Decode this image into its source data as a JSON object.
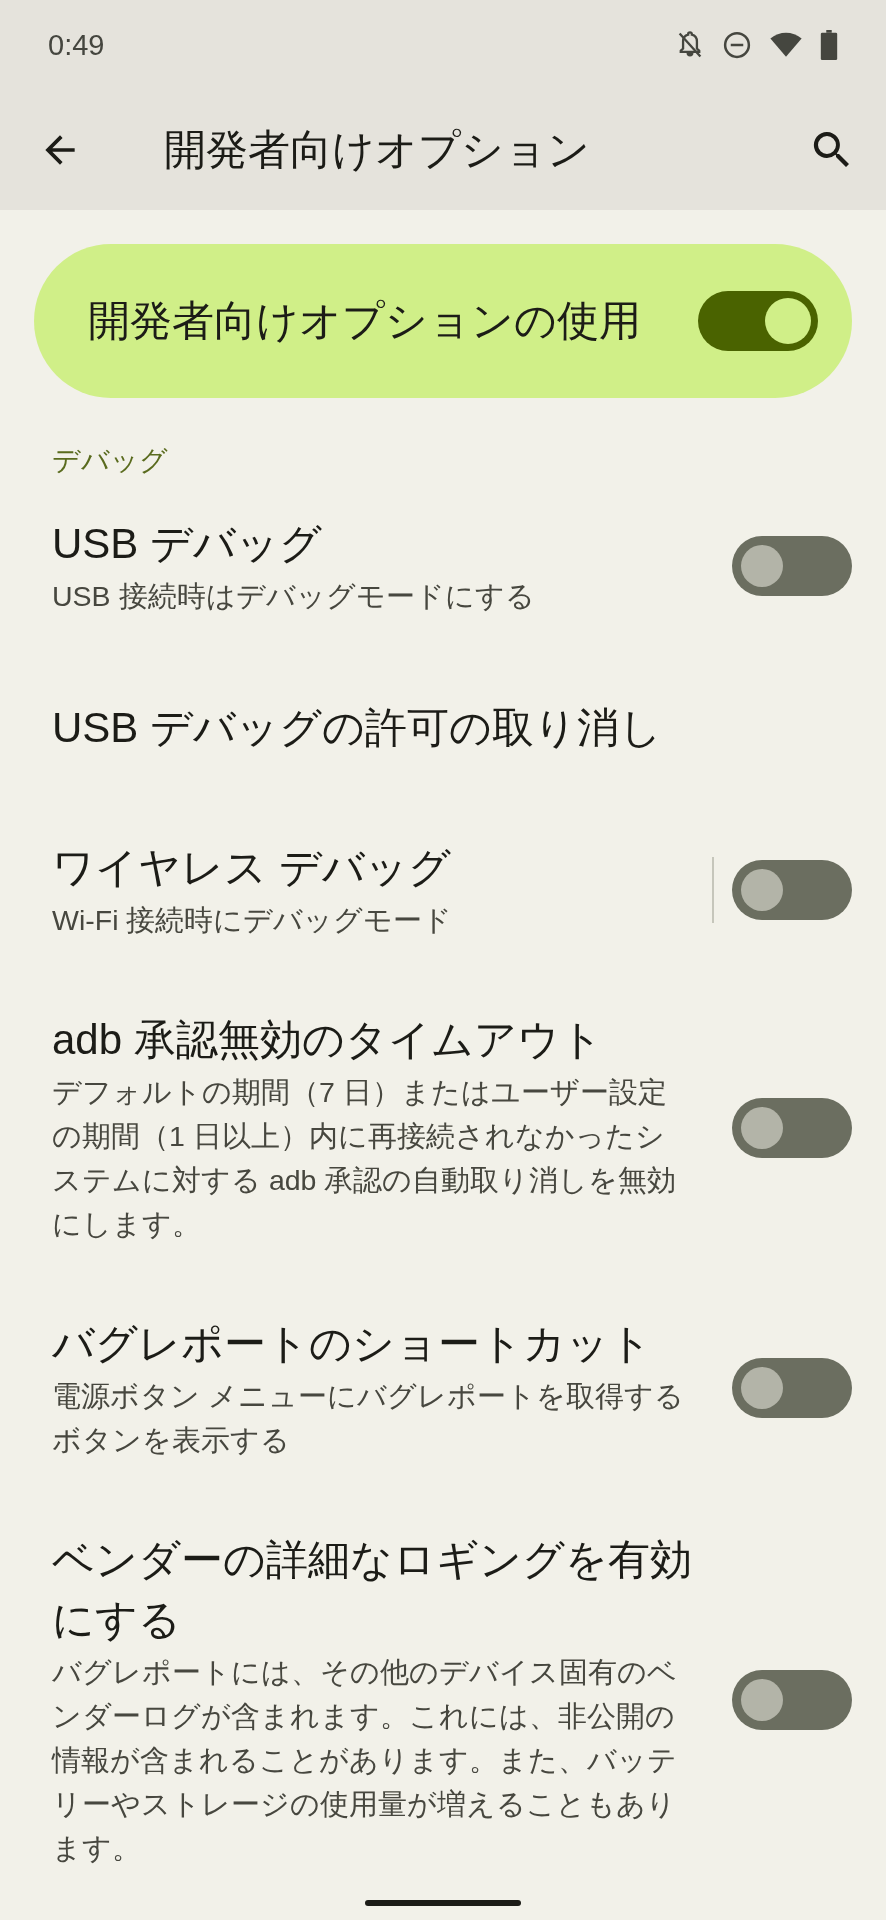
{
  "status_bar": {
    "time": "0:49"
  },
  "app_bar": {
    "title": "開発者向けオプション"
  },
  "main_switch": {
    "label": "開発者向けオプションの使用",
    "on": true
  },
  "section": {
    "title": "デバッグ"
  },
  "items": [
    {
      "kind": "toggle",
      "title": "USB デバッグ",
      "summary": "USB 接続時はデバッグモードにする",
      "on": false,
      "divider": false
    },
    {
      "kind": "plain",
      "title": "USB デバッグの許可の取り消し"
    },
    {
      "kind": "toggle",
      "title": "ワイヤレス デバッグ",
      "summary": "Wi-Fi 接続時にデバッグモード",
      "on": false,
      "divider": true
    },
    {
      "kind": "toggle",
      "title": "adb 承認無効のタイムアウト",
      "summary": "デフォルトの期間（7 日）またはユーザー設定の期間（1 日以上）内に再接続されなかったシステムに対する adb 承認の自動取り消しを無効にします。",
      "on": false,
      "divider": false
    },
    {
      "kind": "toggle",
      "title": "バグレポートのショートカット",
      "summary": "電源ボタン メニューにバグレポートを取得するボタンを表示する",
      "on": false,
      "divider": false
    },
    {
      "kind": "toggle",
      "title": "ベンダーの詳細なロギングを有効にする",
      "summary": "バグレポートには、その他のデバイス固有のベンダーログが含まれます。これには、非公開の情報が含まれることがあります。また、バッテリーやストレージの使用量が増えることもあります。",
      "on": false,
      "divider": false
    }
  ]
}
